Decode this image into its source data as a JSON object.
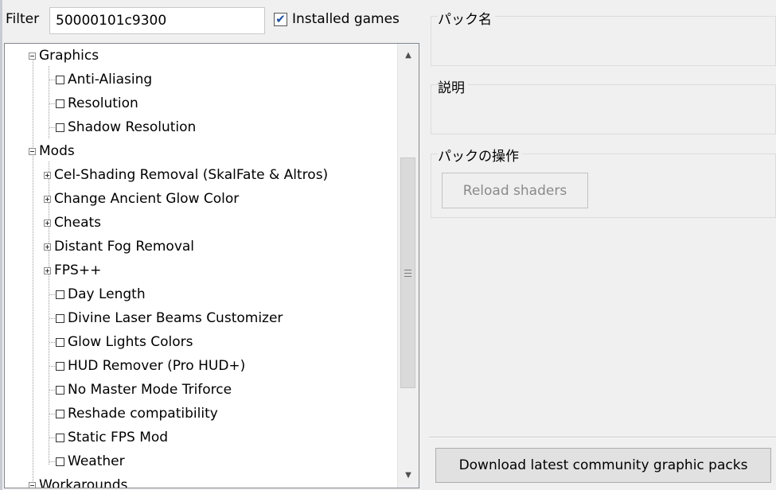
{
  "filter": {
    "label": "Filter",
    "value": "50000101c9300",
    "installed_games_label": "Installed games",
    "installed_games_checked": true
  },
  "tree": {
    "nodes": [
      {
        "label": "Graphics",
        "kind": "group",
        "expanded": true
      },
      {
        "label": "Anti-Aliasing",
        "kind": "leaf"
      },
      {
        "label": "Resolution",
        "kind": "leaf"
      },
      {
        "label": "Shadow Resolution",
        "kind": "leaf"
      },
      {
        "label": "Mods",
        "kind": "group",
        "expanded": true
      },
      {
        "label": "Cel-Shading Removal (SkalFate & Altros)",
        "kind": "group",
        "expanded": false
      },
      {
        "label": "Change Ancient Glow Color",
        "kind": "group",
        "expanded": false
      },
      {
        "label": "Cheats",
        "kind": "group",
        "expanded": false
      },
      {
        "label": "Distant Fog Removal",
        "kind": "group",
        "expanded": false
      },
      {
        "label": "FPS++",
        "kind": "group",
        "expanded": false
      },
      {
        "label": "Day Length",
        "kind": "leaf"
      },
      {
        "label": "Divine Laser Beams Customizer",
        "kind": "leaf"
      },
      {
        "label": "Glow Lights Colors",
        "kind": "leaf"
      },
      {
        "label": "HUD Remover (Pro HUD+)",
        "kind": "leaf"
      },
      {
        "label": "No Master Mode Triforce",
        "kind": "leaf"
      },
      {
        "label": "Reshade compatibility",
        "kind": "leaf"
      },
      {
        "label": "Static FPS Mod",
        "kind": "leaf"
      },
      {
        "label": "Weather",
        "kind": "leaf"
      },
      {
        "label": "Workarounds",
        "kind": "group",
        "expanded": true
      }
    ]
  },
  "panels": {
    "pack_name_title": "パック名",
    "description_title": "説明",
    "pack_actions_title": "パックの操作",
    "reload_shaders_label": "Reload shaders"
  },
  "footer": {
    "download_label": "Download latest community graphic packs"
  },
  "icons": {
    "scroll_up": "scroll-up-icon",
    "scroll_down": "scroll-down-icon",
    "expand": "expand-plus-icon",
    "collapse": "collapse-minus-icon",
    "checkbox": "checkbox-icon"
  }
}
